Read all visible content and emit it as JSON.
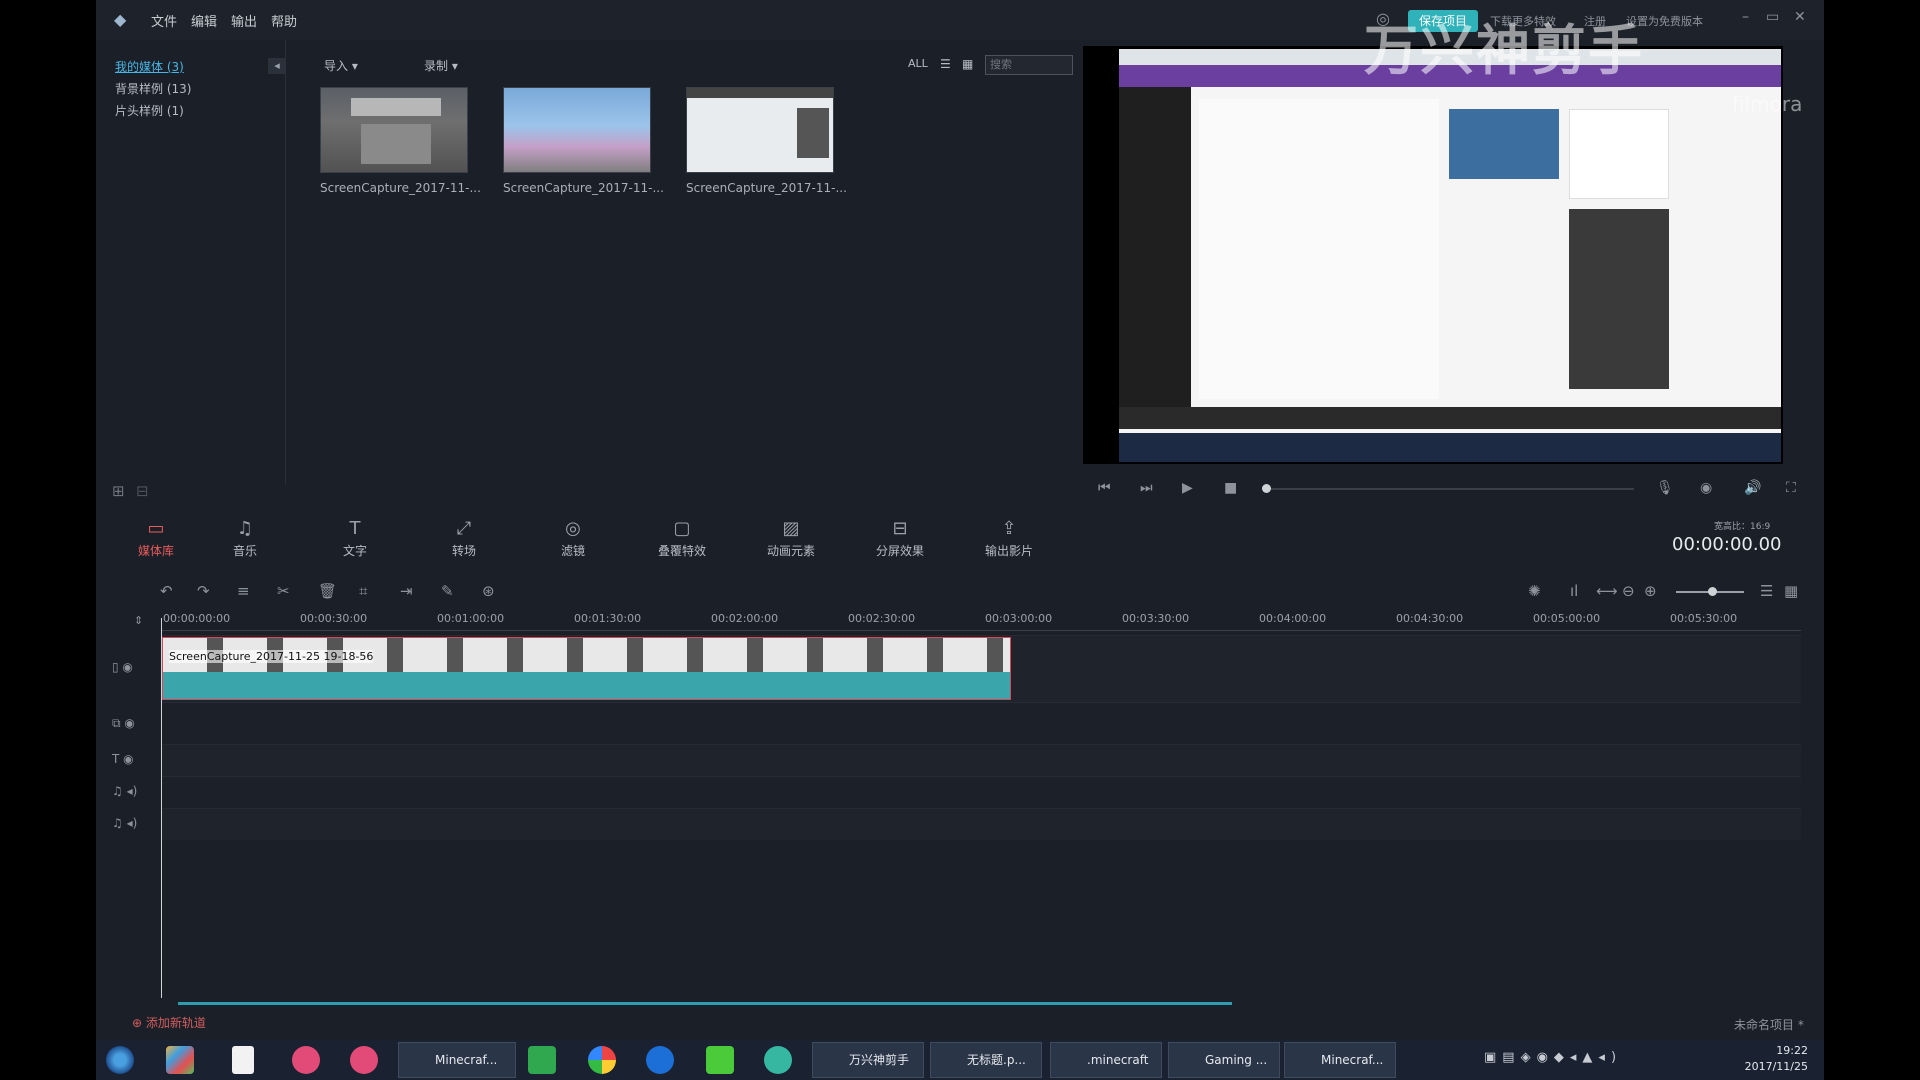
{
  "menu": {
    "file": "文件",
    "edit": "编辑",
    "export": "输出",
    "help": "帮助"
  },
  "titlebar": {
    "save_project": "保存项目",
    "link_download": "下载更多特效",
    "link_register": "注册",
    "link_settings": "设置为免费版本"
  },
  "library": {
    "categories": [
      "我的媒体 (3)",
      "背景样例 (13)",
      "片头样例 (1)"
    ],
    "import_label": "导入 ▾",
    "record_label": "录制 ▾",
    "filter_all": "ALL",
    "search_placeholder": "搜索",
    "items": [
      "ScreenCapture_2017-11-...",
      "ScreenCapture_2017-11-...",
      "ScreenCapture_2017-11-..."
    ]
  },
  "watermark": {
    "main": "万兴神剪手",
    "sub": "filmora"
  },
  "tabs": [
    "媒体库",
    "音乐",
    "文字",
    "转场",
    "滤镜",
    "叠覆特效",
    "动画元素",
    "分屏效果",
    "输出影片"
  ],
  "preview": {
    "ratio": "宽高比：16:9",
    "time": "00:00:00.00"
  },
  "timeline": {
    "ruler": [
      "00:00:00:00",
      "00:00:30:00",
      "00:01:00:00",
      "00:01:30:00",
      "00:02:00:00",
      "00:02:30:00",
      "00:03:00:00",
      "00:03:30:00",
      "00:04:00:00",
      "00:04:30:00",
      "00:05:00:00",
      "00:05:30:00"
    ],
    "clip_label": "ScreenCapture_2017-11-25 19-18-56",
    "add_track": "添加新轨道",
    "project_name": "未命名项目 *"
  },
  "taskbar": {
    "buttons": [
      "Minecraf...",
      "万兴神剪手",
      "无标题.p...",
      ".minecraft",
      "Gaming ...",
      "Minecraf..."
    ],
    "time": "19:22",
    "date": "2017/11/25"
  },
  "colors": {
    "accent": "#2fb2b9",
    "active_tab": "#e85b5b",
    "clip": "#3aa6ab"
  }
}
